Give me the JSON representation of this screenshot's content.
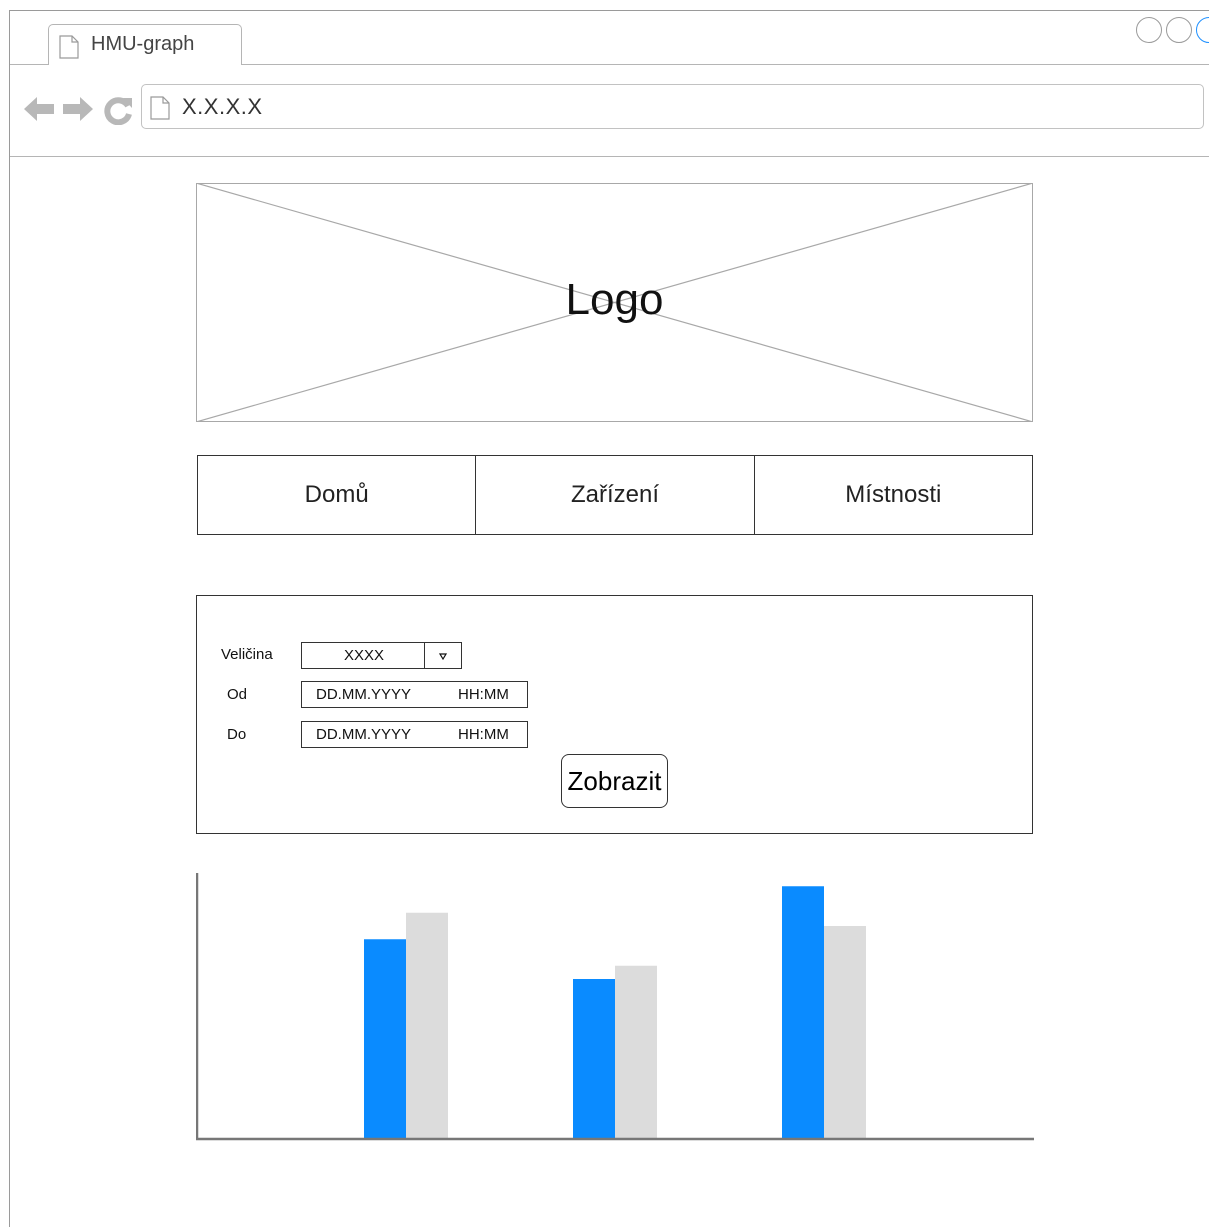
{
  "tab": {
    "title": "HMU-graph"
  },
  "address": {
    "url": "X.X.X.X"
  },
  "logo": {
    "text": "Logo"
  },
  "menu": {
    "items": [
      "Domů",
      "Zařízení",
      "Místnosti"
    ]
  },
  "form": {
    "quantity_label": "Veličina",
    "quantity_value": "XXXX",
    "from_label": "Od",
    "from_date": "DD.MM.YYYY",
    "from_time": "HH:MM",
    "to_label": "Do",
    "to_date": "DD.MM.YYYY",
    "to_time": "HH:MM",
    "submit_label": "Zobrazit"
  },
  "chart_data": {
    "type": "bar",
    "categories": [
      "",
      "",
      ""
    ],
    "series": [
      {
        "values": [
          75,
          60,
          95
        ],
        "color": "#0a8bff"
      },
      {
        "values": [
          85,
          65,
          80
        ],
        "color": "#dcdcdc"
      }
    ],
    "ylim": [
      0,
      100
    ],
    "grid": false
  },
  "colors": {
    "accent": "#0a8bff",
    "secondary": "#dcdcdc",
    "axis": "#777777"
  }
}
